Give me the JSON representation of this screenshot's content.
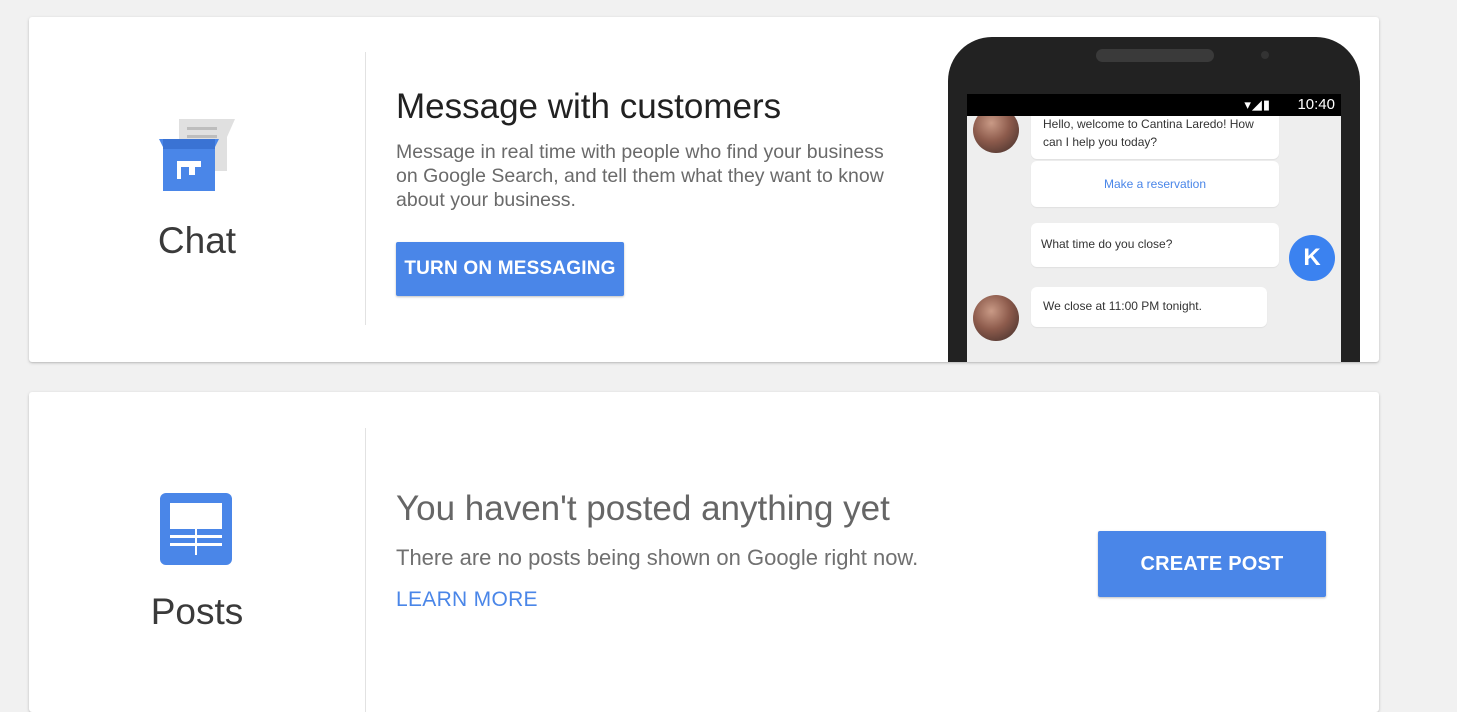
{
  "chat_card": {
    "label": "Chat",
    "title": "Message with customers",
    "description": "Message in real time with people who find your business on Google Search, and tell them what they want to know about your business.",
    "button_label": "TURN ON MESSAGING",
    "icon": "chat-store-icon"
  },
  "phone": {
    "status_time": "10:40",
    "status_icons": "▾◢▮",
    "messages": {
      "greeting": "Hello, welcome to Cantina Laredo! How can I help you today?",
      "reservation": "Make a reservation",
      "question": "What time do you close?",
      "user_initial": "K",
      "reply": "We close at 11:00 PM tonight."
    }
  },
  "posts_card": {
    "label": "Posts",
    "title": "You haven't posted anything yet",
    "description": "There are no posts being shown on Google right now.",
    "learn_more": "LEARN MORE",
    "button_label": "CREATE POST",
    "icon": "posts-icon"
  },
  "colors": {
    "accent": "#4a86e8",
    "background": "#f1f1f1",
    "card": "#ffffff"
  }
}
